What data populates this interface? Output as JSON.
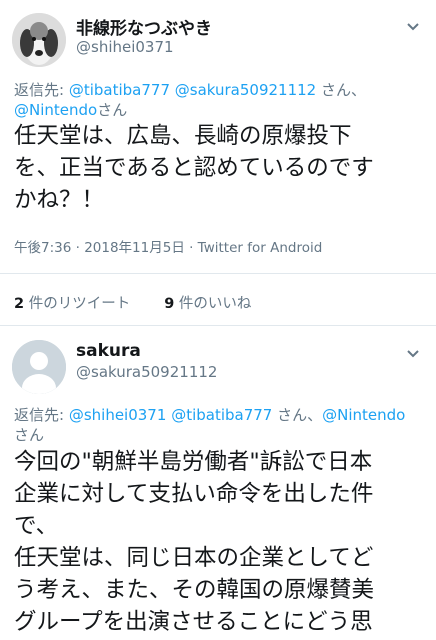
{
  "tweet1": {
    "display_name": "非線形なつぶやき",
    "handle": "@shihei0371",
    "reply_prefix": "返信先: ",
    "reply_mentions": [
      "@tibatiba777",
      "@sakura50921112",
      "@Nintendo"
    ],
    "reply_suffix_1": " さん、",
    "reply_suffix_2": "さん",
    "text_lines": [
      "任天堂は、広島、長崎の原爆投下",
      "を、正当であると認めているのです",
      "かね？！"
    ],
    "timestamp": "午後7:36 · 2018年11月5日 · Twitter for Android",
    "retweets_count": "2",
    "retweets_label": " 件のリツイート",
    "likes_count": "9",
    "likes_label": " 件のいいね"
  },
  "tweet2": {
    "display_name": "sakura",
    "handle": "@sakura50921112",
    "reply_prefix": "返信先: ",
    "reply_mentions": [
      "@shihei0371",
      "@tibatiba777",
      "@Nintendo"
    ],
    "reply_suffix_1": " さん、",
    "reply_suffix_2": "さん",
    "text_lines": [
      "今回の\"朝鮮半島労働者\"訴訟で日本",
      "企業に対して支払い命令を出した件",
      "で、",
      "任天堂は、同じ日本の企業としてど",
      "う考え、また、その韓国の原爆賛美",
      "グループを出演させることにどう思"
    ]
  },
  "icons": {
    "menu": "chevron-down-icon",
    "avatar1": "dog-photo-avatar",
    "avatar2": "default-profile-avatar"
  },
  "colors": {
    "link": "#1da1f2",
    "secondary": "#657786",
    "text": "#14171a",
    "divider": "#e1e8ed"
  }
}
